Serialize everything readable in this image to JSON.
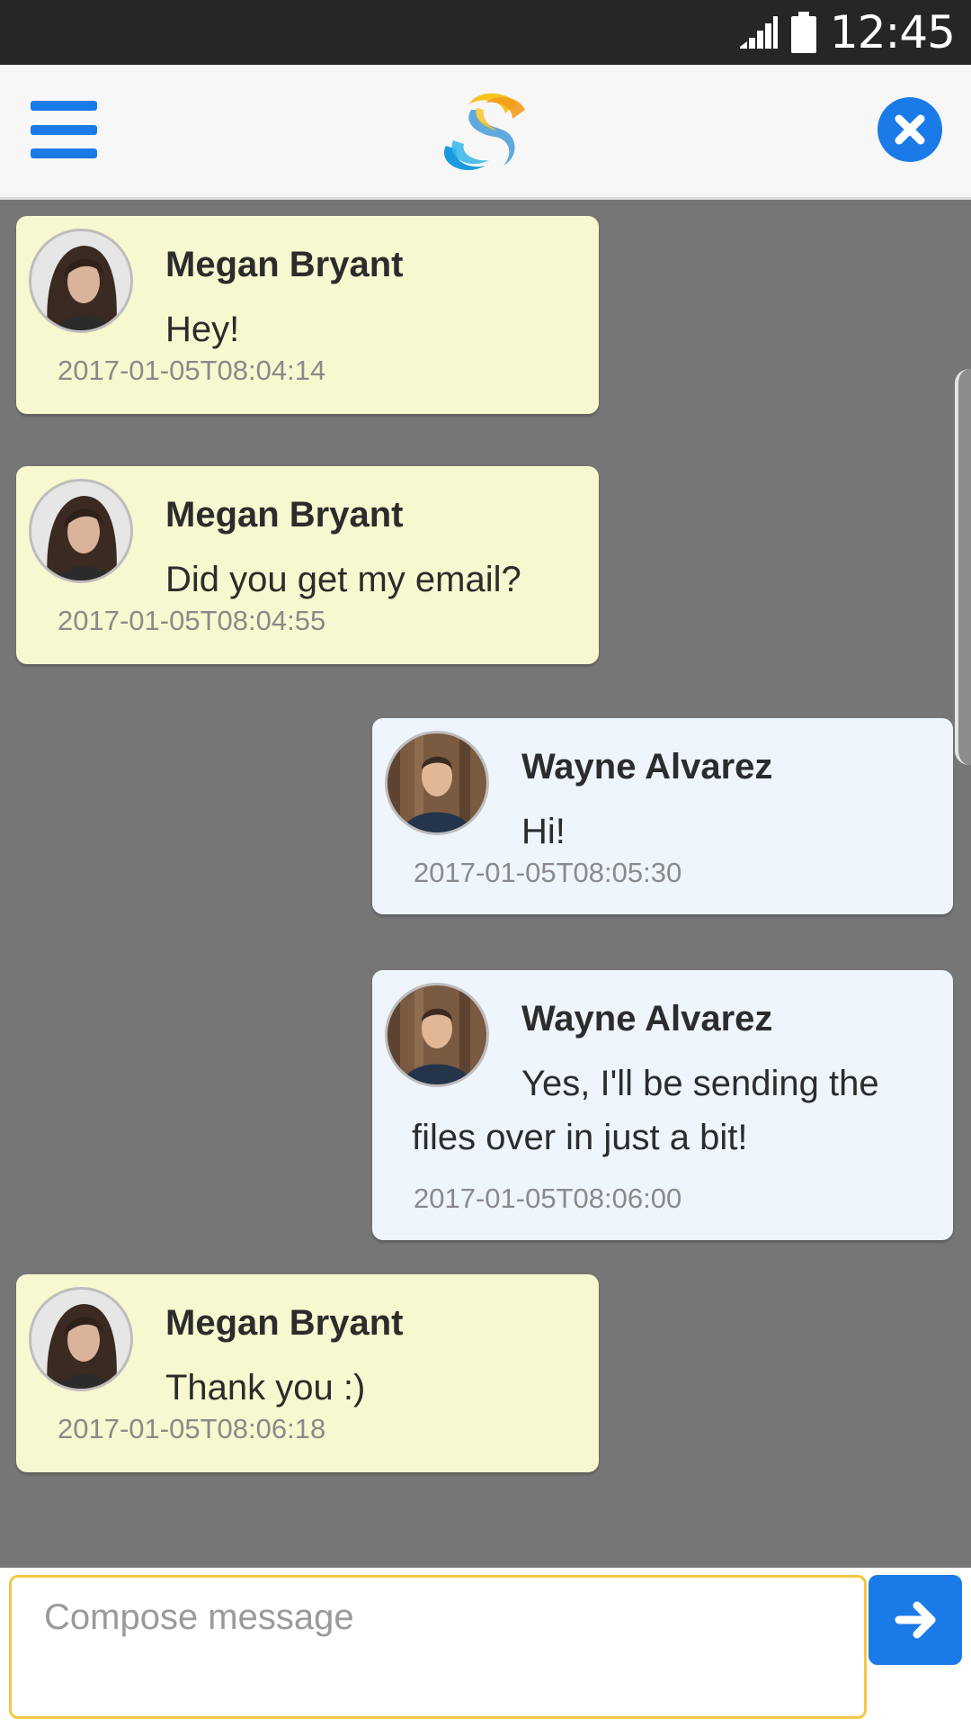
{
  "status_bar": {
    "time": "12:45"
  },
  "composer": {
    "placeholder": "Compose message"
  },
  "colors": {
    "accent": "#1a7be8",
    "incoming_bubble": "#f8f8d0",
    "outgoing_bubble": "#eef5fd",
    "input_border": "#f3c843"
  },
  "icons": {
    "menu": "menu-icon",
    "logo": "app-logo",
    "close": "close-icon",
    "send": "arrow-right-icon",
    "signal": "signal-icon",
    "battery": "battery-icon"
  },
  "messages": [
    {
      "sender": "Megan Bryant",
      "text": "Hey!",
      "timestamp": "2017-01-05T08:04:14",
      "direction": "incoming"
    },
    {
      "sender": "Megan Bryant",
      "text": "Did you get my email?",
      "timestamp": "2017-01-05T08:04:55",
      "direction": "incoming"
    },
    {
      "sender": "Wayne Alvarez",
      "text": "Hi!",
      "timestamp": "2017-01-05T08:05:30",
      "direction": "outgoing"
    },
    {
      "sender": "Wayne Alvarez",
      "text_line1": "Yes, I'll be sending the",
      "text_line2": "files over in just a bit!",
      "timestamp": "2017-01-05T08:06:00",
      "direction": "outgoing"
    },
    {
      "sender": "Megan Bryant",
      "text": "Thank you :)",
      "timestamp": "2017-01-05T08:06:18",
      "direction": "incoming"
    }
  ]
}
